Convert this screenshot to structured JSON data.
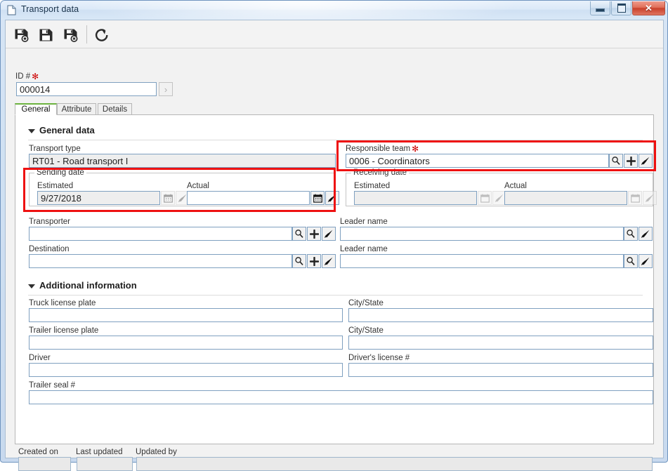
{
  "window": {
    "title": "Transport data",
    "icon": "document-icon",
    "buttons": {
      "minimize": "Minimize",
      "maximize": "Maximize",
      "close": "Close"
    }
  },
  "toolbar": {
    "items": [
      {
        "name": "save-new-button",
        "icon": "floppy-new-icon",
        "tooltip": "Save new"
      },
      {
        "name": "save-button",
        "icon": "floppy-save-icon",
        "tooltip": "Save"
      },
      {
        "name": "save-delete-button",
        "icon": "floppy-delete-icon",
        "tooltip": "Delete"
      },
      {
        "name": "refresh-button",
        "icon": "refresh-icon",
        "tooltip": "Refresh"
      }
    ]
  },
  "id_field": {
    "label": "ID #",
    "required_marker": "✻",
    "value": "000014",
    "next_button": "›"
  },
  "tabs": [
    {
      "label": "General",
      "active": true
    },
    {
      "label": "Attribute",
      "active": false
    },
    {
      "label": "Details",
      "active": false
    }
  ],
  "sections": {
    "general": {
      "title": "General data",
      "transport_type": {
        "label": "Transport type",
        "value": "RT01 - Road transport I",
        "readonly": true
      },
      "responsible_team": {
        "label": "Responsible team",
        "required_marker": "✻",
        "value": "0006 - Coordinators",
        "readonly": false,
        "highlighted": true,
        "buttons": [
          "search-icon",
          "plus-icon",
          "brush-icon"
        ]
      },
      "sending_date": {
        "caption": "Sending date",
        "highlighted": true,
        "estimated": {
          "label": "Estimated",
          "value": "9/27/2018",
          "readonly": true,
          "buttons": [
            "calendar-icon",
            "brush-icon"
          ]
        },
        "actual": {
          "label": "Actual",
          "value": "",
          "readonly": false,
          "buttons": [
            "calendar-icon",
            "brush-icon"
          ]
        }
      },
      "receiving_date": {
        "caption": "Receiving date",
        "highlighted": false,
        "estimated": {
          "label": "Estimated",
          "value": "",
          "readonly": true,
          "buttons": [
            "calendar-icon",
            "brush-icon"
          ]
        },
        "actual": {
          "label": "Actual",
          "value": "",
          "readonly": true,
          "buttons": [
            "calendar-icon",
            "brush-icon"
          ]
        }
      },
      "transporter": {
        "label": "Transporter",
        "value": "",
        "buttons": [
          "search-icon",
          "plus-icon",
          "brush-icon"
        ]
      },
      "transporter_leader": {
        "label": "Leader name",
        "value": "",
        "buttons": [
          "search-icon",
          "brush-icon"
        ]
      },
      "destination": {
        "label": "Destination",
        "value": "",
        "buttons": [
          "search-icon",
          "plus-icon",
          "brush-icon"
        ]
      },
      "destination_leader": {
        "label": "Leader name",
        "value": "",
        "buttons": [
          "search-icon",
          "brush-icon"
        ]
      }
    },
    "additional": {
      "title": "Additional information",
      "fields": [
        {
          "name": "truck-license-plate",
          "label": "Truck license plate",
          "value": "",
          "col": "left",
          "row": 0
        },
        {
          "name": "truck-city-state",
          "label": "City/State",
          "value": "",
          "col": "right",
          "row": 0
        },
        {
          "name": "trailer-license-plate",
          "label": "Trailer license plate",
          "value": "",
          "col": "left",
          "row": 1
        },
        {
          "name": "trailer-city-state",
          "label": "City/State",
          "value": "",
          "col": "right",
          "row": 1
        },
        {
          "name": "driver",
          "label": "Driver",
          "value": "",
          "col": "left",
          "row": 2
        },
        {
          "name": "drivers-license",
          "label": "Driver's license #",
          "value": "",
          "col": "right",
          "row": 2
        },
        {
          "name": "trailer-seal",
          "label": "Trailer seal #",
          "value": "",
          "col": "full",
          "row": 3
        }
      ]
    }
  },
  "footer": {
    "created_on": {
      "label": "Created on",
      "value": ""
    },
    "last_updated": {
      "label": "Last updated",
      "value": ""
    },
    "updated_by": {
      "label": "Updated by",
      "value": ""
    }
  },
  "colors": {
    "highlight": "#ee1111",
    "active_tab_accent": "#6cb33f",
    "required": "#cc0000",
    "field_border": "#7fa0c0"
  }
}
